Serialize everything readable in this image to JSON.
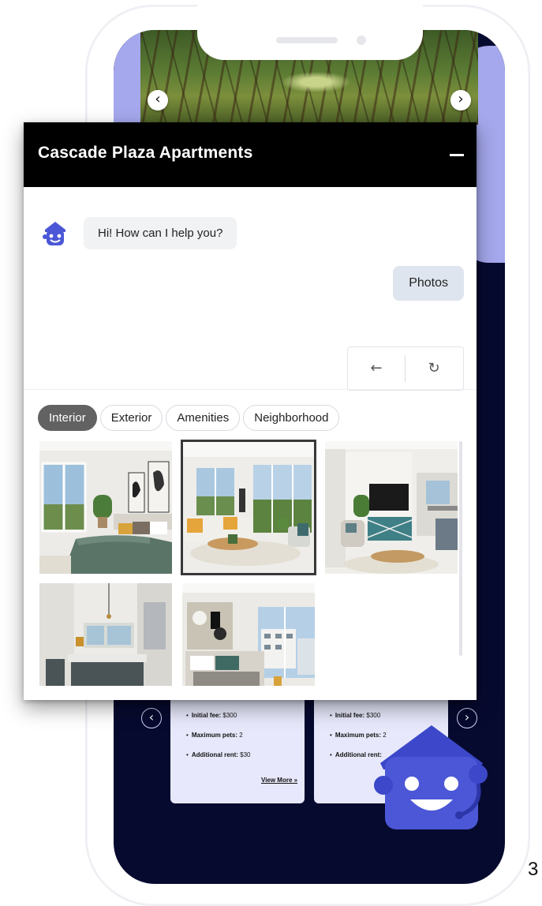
{
  "widget": {
    "title": "Cascade Plaza Apartments",
    "minimize_icon": "minimize-icon"
  },
  "chat": {
    "bot_message": "Hi! How can I help you?",
    "user_message": "Photos",
    "back_icon": "←",
    "refresh_icon": "↻"
  },
  "tabs": [
    {
      "label": "Interior",
      "active": true
    },
    {
      "label": "Exterior",
      "active": false
    },
    {
      "label": "Amenities",
      "active": false
    },
    {
      "label": "Neighborhood",
      "active": false
    }
  ],
  "photos": [
    {
      "subject": "bedroom",
      "selected": false
    },
    {
      "subject": "living-room",
      "selected": true
    },
    {
      "subject": "living-room-tv",
      "selected": false
    },
    {
      "subject": "kitchen",
      "selected": false
    },
    {
      "subject": "bedroom-window",
      "selected": false
    }
  ],
  "background_cards": [
    {
      "items": [
        {
          "label": "Initial fee:",
          "value": "$300"
        },
        {
          "label": "Maximum pets:",
          "value": "2"
        },
        {
          "label": "Additional rent:",
          "value": "$30"
        }
      ],
      "link": "View More »"
    },
    {
      "items": [
        {
          "label": "Initial fee:",
          "value": "$300"
        },
        {
          "label": "Maximum pets:",
          "value": "2"
        },
        {
          "label": "Additional rent:",
          "value": ""
        }
      ]
    }
  ],
  "carousel": {
    "prev_icon": "‹",
    "next_icon": "›"
  },
  "colors": {
    "screen_bg": "#070a2f",
    "lavender": "#a5a8ec",
    "header_bg": "#000000",
    "active_tab": "#626262",
    "mascot_blue": "#4b57d6"
  },
  "page_number": "3"
}
